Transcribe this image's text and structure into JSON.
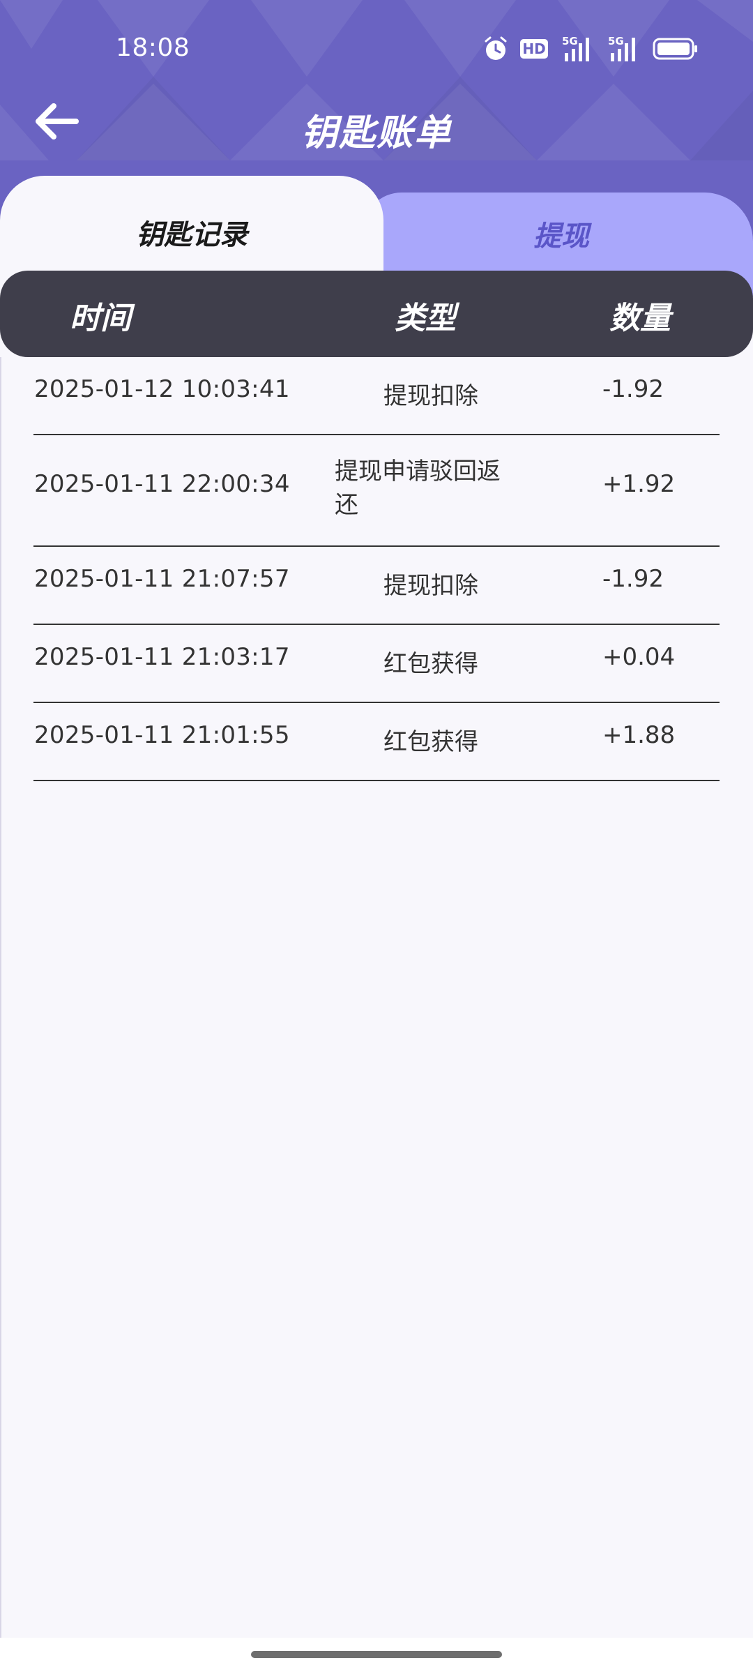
{
  "status_bar": {
    "time": "18:08",
    "icons": [
      "alarm-icon",
      "hd-icon",
      "signal-5g-icon",
      "signal-5g-icon",
      "battery-icon"
    ],
    "hd_label": "HD",
    "network_label": "5G"
  },
  "header": {
    "title": "钥匙账单",
    "back_icon": "arrow-left-icon"
  },
  "tabs": [
    {
      "label": "钥匙记录",
      "active": true
    },
    {
      "label": "提现",
      "active": false
    }
  ],
  "table": {
    "columns": [
      "时间",
      "类型",
      "数量"
    ],
    "rows": [
      {
        "time": "2025-01-12 10:03:41",
        "type": "提现扣除",
        "amount": "-1.92"
      },
      {
        "time": "2025-01-11 22:00:34",
        "type": "提现申请驳回返还",
        "amount": "+1.92"
      },
      {
        "time": "2025-01-11 21:07:57",
        "type": "提现扣除",
        "amount": "-1.92"
      },
      {
        "time": "2025-01-11 21:03:17",
        "type": "红包获得",
        "amount": "+0.04"
      },
      {
        "time": "2025-01-11 21:01:55",
        "type": "红包获得",
        "amount": "+1.88"
      }
    ]
  },
  "colors": {
    "header_bg": "#6a63c2",
    "inactive_tab_bg": "#a9a7fb",
    "inactive_tab_text": "#5a55c8",
    "table_header_bg": "#3f3e4b",
    "page_bg": "#f8f7fc"
  }
}
